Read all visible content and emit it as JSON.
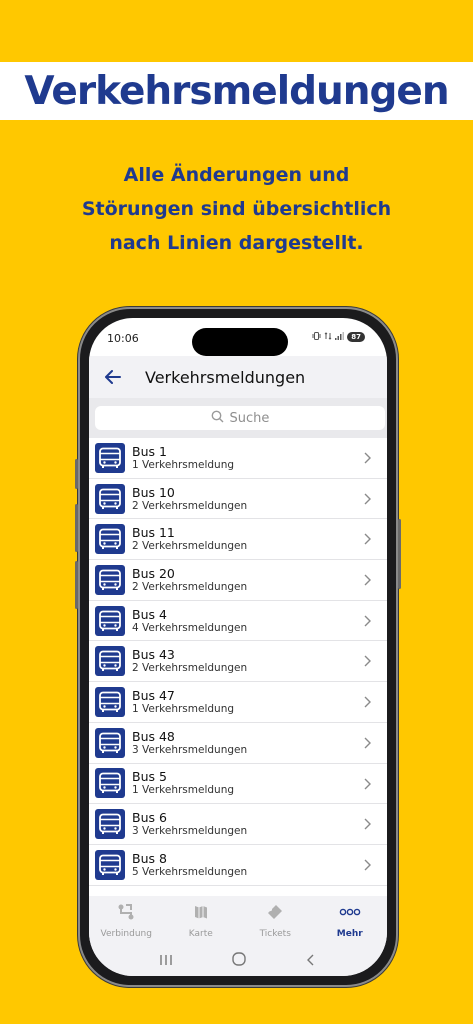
{
  "banner": {
    "title": "Verkehrsmeldungen"
  },
  "subtitle": {
    "lines": [
      "Alle Änderungen und",
      "Störungen sind übersichtlich",
      "nach Linien dargestellt."
    ]
  },
  "status_bar": {
    "time": "10:06",
    "battery": "87"
  },
  "appbar": {
    "title": "Verkehrsmeldungen"
  },
  "search": {
    "placeholder": "Suche"
  },
  "lines": [
    {
      "title": "Bus 1",
      "subtitle": "1 Verkehrsmeldung"
    },
    {
      "title": "Bus 10",
      "subtitle": "2 Verkehrsmeldungen"
    },
    {
      "title": "Bus 11",
      "subtitle": "2 Verkehrsmeldungen"
    },
    {
      "title": "Bus 20",
      "subtitle": "2 Verkehrsmeldungen"
    },
    {
      "title": "Bus 4",
      "subtitle": "4 Verkehrsmeldungen"
    },
    {
      "title": "Bus 43",
      "subtitle": "2 Verkehrsmeldungen"
    },
    {
      "title": "Bus 47",
      "subtitle": "1 Verkehrsmeldung"
    },
    {
      "title": "Bus 48",
      "subtitle": "3 Verkehrsmeldungen"
    },
    {
      "title": "Bus 5",
      "subtitle": "1 Verkehrsmeldung"
    },
    {
      "title": "Bus 6",
      "subtitle": "3 Verkehrsmeldungen"
    },
    {
      "title": "Bus 8",
      "subtitle": "5 Verkehrsmeldungen"
    }
  ],
  "tabs": [
    {
      "label": "Verbindung",
      "icon": "route-icon"
    },
    {
      "label": "Karte",
      "icon": "map-icon"
    },
    {
      "label": "Tickets",
      "icon": "ticket-icon"
    },
    {
      "label": "Mehr",
      "icon": "more-icon",
      "active": true
    }
  ],
  "colors": {
    "accent": "#1F3A8F",
    "background": "#FFC800"
  }
}
